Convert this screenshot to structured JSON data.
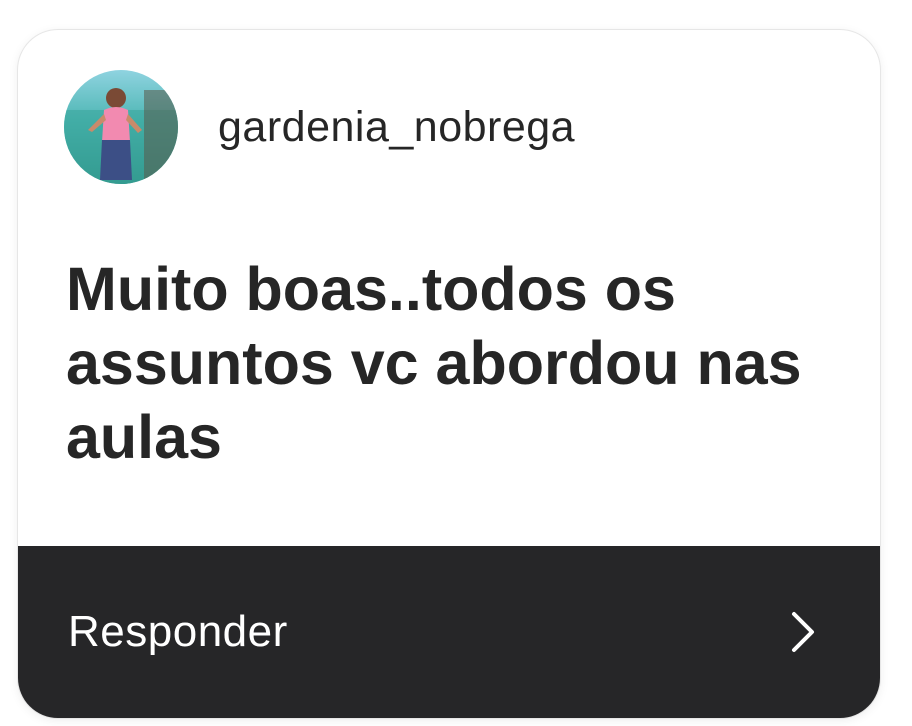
{
  "comment": {
    "username": "gardenia_nobrega",
    "avatar_icon": "user-avatar-photo",
    "text": "Muito boas..todos os assuntos vc abordou nas aulas"
  },
  "reply": {
    "label": "Responder",
    "icon": "chevron-right-icon"
  },
  "colors": {
    "card_bg": "#ffffff",
    "text": "#262626",
    "reply_bar_bg": "#262628",
    "reply_text": "#ffffff"
  }
}
